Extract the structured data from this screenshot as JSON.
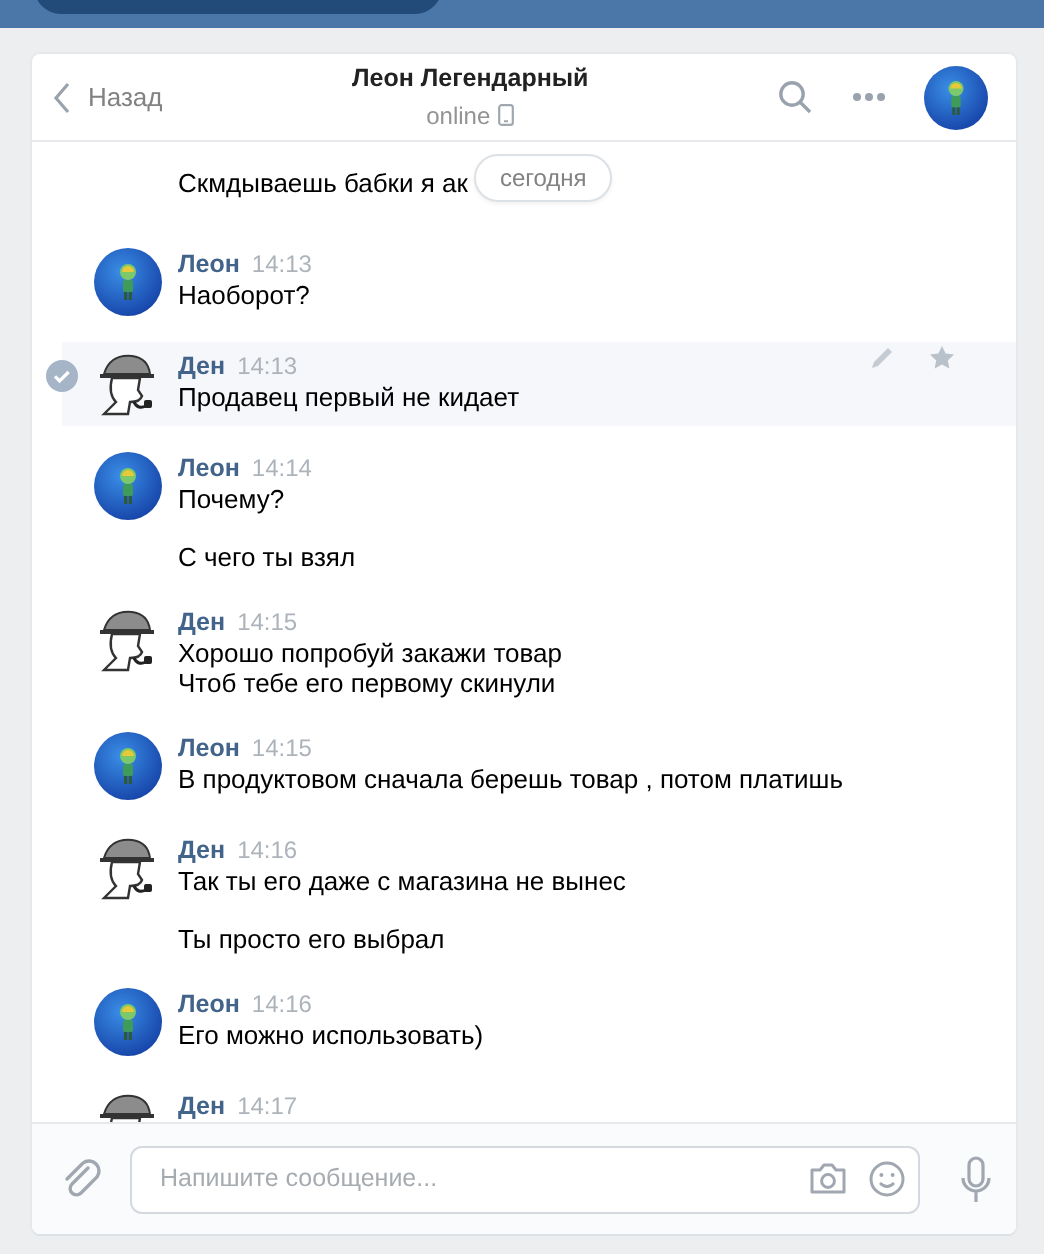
{
  "header": {
    "back": "Назад",
    "title": "Леон Легендарный",
    "status": "online"
  },
  "partial_message": "Скмдываешь бабки я ак",
  "date_pill": "сегодня",
  "messages": [
    {
      "author": "Леон",
      "time": "14:13",
      "kind": "globe",
      "selected": false,
      "paragraphs": [
        [
          "Наоборот?"
        ]
      ]
    },
    {
      "author": "Ден",
      "time": "14:13",
      "kind": "detective",
      "selected": true,
      "paragraphs": [
        [
          "Продавец первый не кидает"
        ]
      ]
    },
    {
      "author": "Леон",
      "time": "14:14",
      "kind": "globe",
      "selected": false,
      "paragraphs": [
        [
          "Почему?"
        ],
        [
          "С чего ты взял"
        ]
      ]
    },
    {
      "author": "Ден",
      "time": "14:15",
      "kind": "detective",
      "selected": false,
      "paragraphs": [
        [
          "Хорошо попробуй закажи товар",
          "Чтоб тебе его первому скинули"
        ]
      ]
    },
    {
      "author": "Леон",
      "time": "14:15",
      "kind": "globe",
      "selected": false,
      "paragraphs": [
        [
          "В продуктовом сначала берешь товар , потом платишь"
        ]
      ]
    },
    {
      "author": "Ден",
      "time": "14:16",
      "kind": "detective",
      "selected": false,
      "paragraphs": [
        [
          "Так ты его даже с магазина не вынес"
        ],
        [
          "Ты просто его выбрал"
        ]
      ]
    },
    {
      "author": "Леон",
      "time": "14:16",
      "kind": "globe",
      "selected": false,
      "paragraphs": [
        [
          "Его можно использовать)"
        ]
      ]
    },
    {
      "author": "Ден",
      "time": "14:17",
      "kind": "detective",
      "selected": false
    }
  ],
  "composer": {
    "placeholder": "Напишите сообщение..."
  }
}
